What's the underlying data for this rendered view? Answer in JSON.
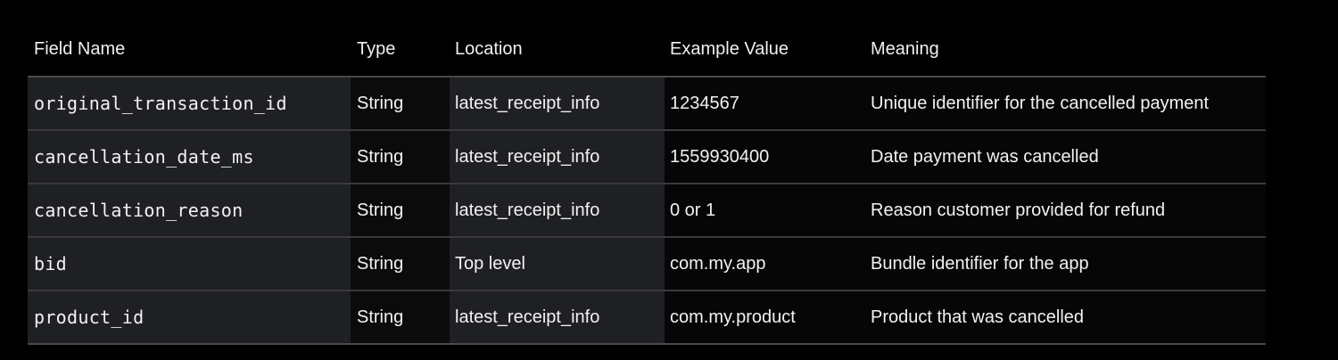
{
  "table": {
    "headers": [
      "Field Name",
      "Type",
      "Location",
      "Example Value",
      "Meaning"
    ],
    "rows": [
      {
        "field": "original_transaction_id",
        "type": "String",
        "location": "latest_receipt_info",
        "example": "1234567",
        "meaning": "Unique identifier for the cancelled payment"
      },
      {
        "field": "cancellation_date_ms",
        "type": "String",
        "location": "latest_receipt_info",
        "example": "1559930400",
        "meaning": "Date payment was cancelled"
      },
      {
        "field": "cancellation_reason",
        "type": "String",
        "location": "latest_receipt_info",
        "example": "0 or 1",
        "meaning": "Reason customer provided for refund"
      },
      {
        "field": "bid",
        "type": "String",
        "location": "Top level",
        "example": "com.my.app",
        "meaning": "Bundle identifier for the app"
      },
      {
        "field": "product_id",
        "type": "String",
        "location": "latest_receipt_info",
        "example": "com.my.product",
        "meaning": "Product that was cancelled"
      }
    ]
  },
  "colors": {
    "background": "#000000",
    "shaded_column": "#1f2024",
    "divider": "#4a4a4c",
    "text": "#f2f2f2"
  }
}
